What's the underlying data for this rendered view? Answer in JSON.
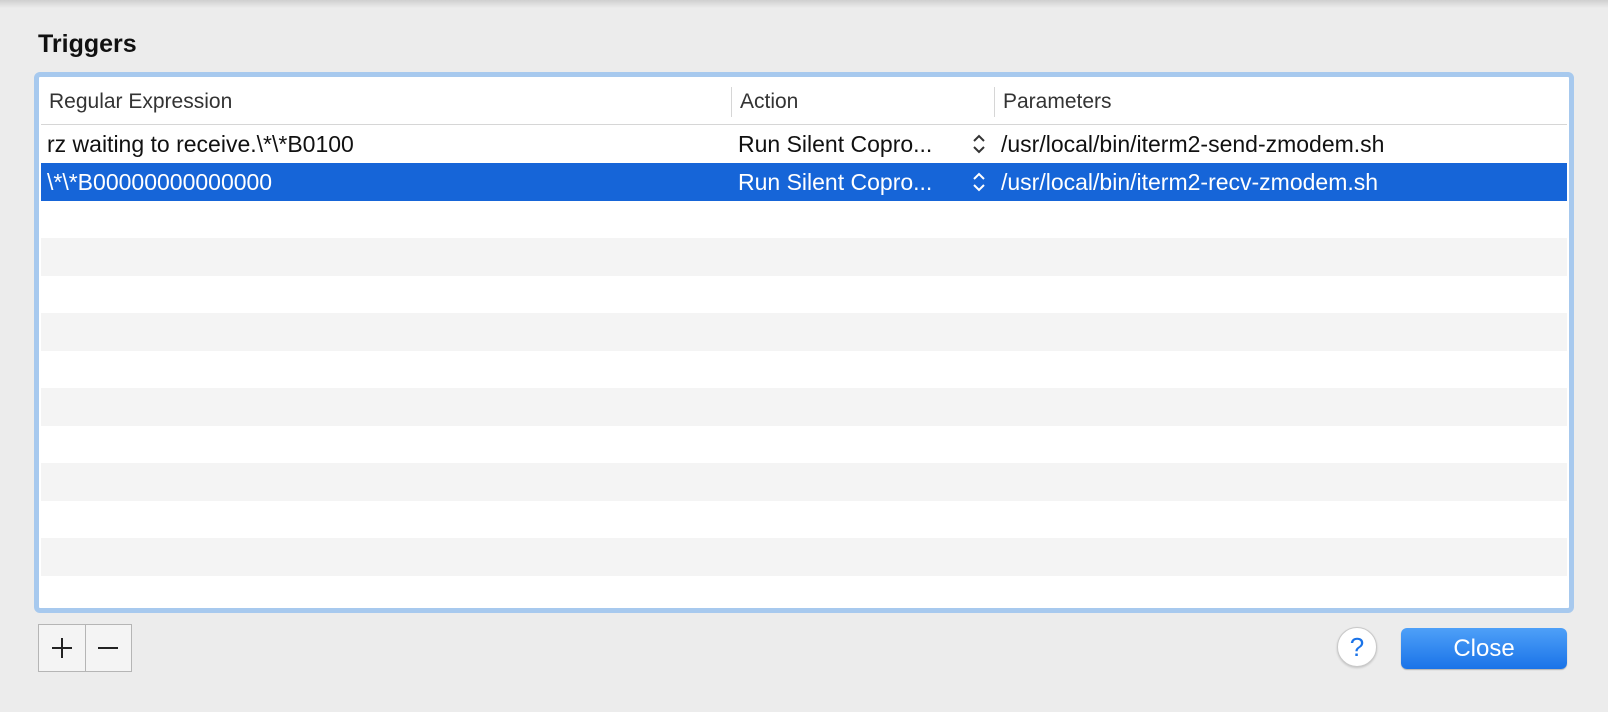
{
  "colors": {
    "background": "#ececec",
    "focus_ring": "#a7c9ee",
    "selection": "#1665d8",
    "accent": "#1a73e8"
  },
  "title": "Triggers",
  "table": {
    "columns": [
      "Regular Expression",
      "Action",
      "Parameters"
    ],
    "rows": [
      {
        "regex": "rz waiting to receive.\\*\\*B0100",
        "action": "Run Silent Copro...",
        "parameters": "/usr/local/bin/iterm2-send-zmodem.sh",
        "selected": false
      },
      {
        "regex": "\\*\\*B00000000000000",
        "action": "Run Silent Copro...",
        "parameters": "/usr/local/bin/iterm2-recv-zmodem.sh",
        "selected": true
      }
    ]
  },
  "buttons": {
    "add_icon": "plus-icon",
    "remove_icon": "minus-icon",
    "help": "?",
    "close": "Close"
  }
}
